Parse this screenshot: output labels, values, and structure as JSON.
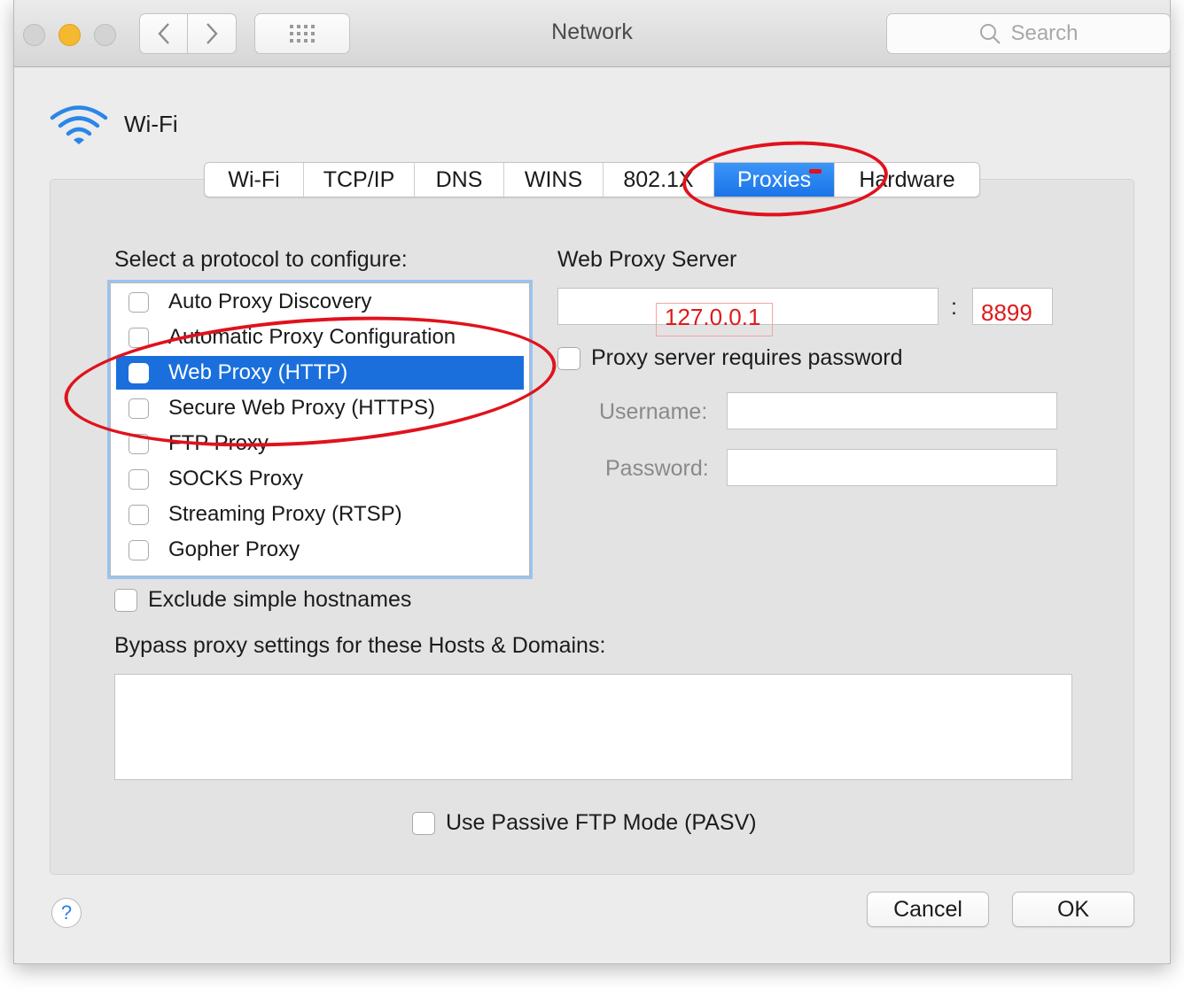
{
  "window": {
    "title": "Network",
    "search_placeholder": "Search"
  },
  "interface": {
    "name": "Wi-Fi",
    "icon": "wifi-icon"
  },
  "tabs": [
    {
      "label": "Wi-Fi",
      "active": false
    },
    {
      "label": "TCP/IP",
      "active": false
    },
    {
      "label": "DNS",
      "active": false
    },
    {
      "label": "WINS",
      "active": false
    },
    {
      "label": "802.1X",
      "active": false
    },
    {
      "label": "Proxies",
      "active": true
    },
    {
      "label": "Hardware",
      "active": false
    }
  ],
  "protocols": {
    "heading": "Select a protocol to configure:",
    "items": [
      {
        "label": "Auto Proxy Discovery",
        "checked": false,
        "selected": false
      },
      {
        "label": "Automatic Proxy Configuration",
        "checked": false,
        "selected": false
      },
      {
        "label": "Web Proxy (HTTP)",
        "checked": false,
        "selected": true
      },
      {
        "label": "Secure Web Proxy (HTTPS)",
        "checked": false,
        "selected": false
      },
      {
        "label": "FTP Proxy",
        "checked": false,
        "selected": false
      },
      {
        "label": "SOCKS Proxy",
        "checked": false,
        "selected": false
      },
      {
        "label": "Streaming Proxy (RTSP)",
        "checked": false,
        "selected": false
      },
      {
        "label": "Gopher Proxy",
        "checked": false,
        "selected": false
      }
    ]
  },
  "proxy_server": {
    "heading": "Web Proxy Server",
    "host": "127.0.0.1",
    "separator": ":",
    "port": "8899",
    "requires_password_label": "Proxy server requires password",
    "username_label": "Username:",
    "password_label": "Password:",
    "username": "",
    "password": ""
  },
  "exclude_simple_hostnames_label": "Exclude simple hostnames",
  "bypass": {
    "label": "Bypass proxy settings for these Hosts & Domains:",
    "value": ""
  },
  "passive_ftp_label": "Use Passive FTP Mode (PASV)",
  "buttons": {
    "help": "?",
    "cancel": "Cancel",
    "ok": "OK"
  },
  "colors": {
    "accent": "#1a74e8",
    "annotation": "#e0121d"
  }
}
